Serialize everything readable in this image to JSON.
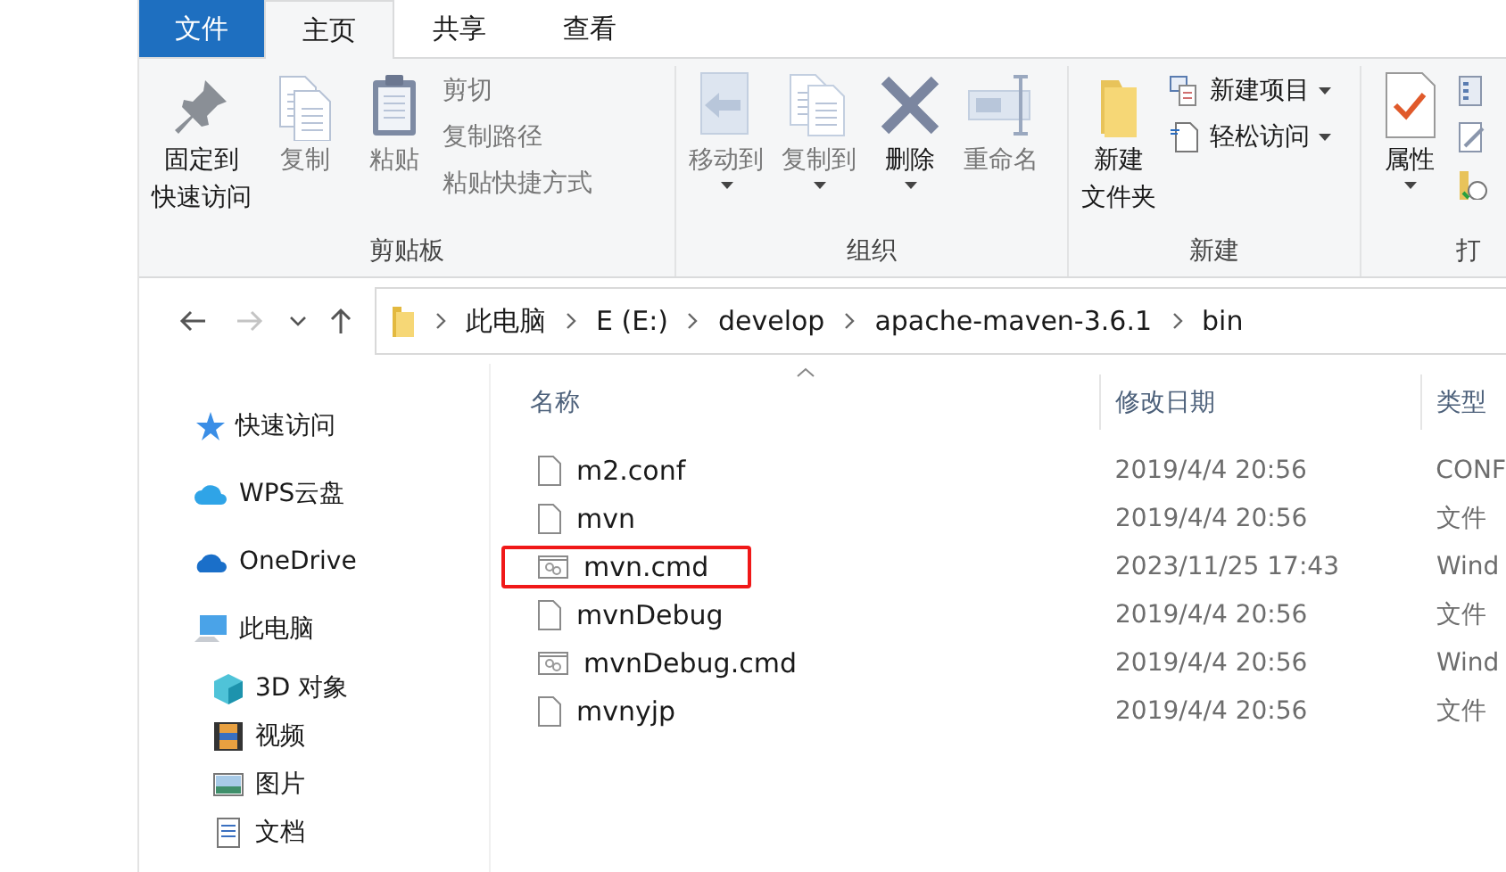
{
  "ribbon_tabs": [
    {
      "label": "文件",
      "kind": "file",
      "selected": false
    },
    {
      "label": "主页",
      "kind": "tab",
      "selected": true
    },
    {
      "label": "共享",
      "kind": "tab",
      "selected": false
    },
    {
      "label": "查看",
      "kind": "tab",
      "selected": false
    }
  ],
  "ribbon_groups": [
    {
      "label": "剪贴板",
      "items": [
        {
          "lines": [
            "固定到",
            "快速访问"
          ],
          "kind": "large",
          "disabled": false,
          "dropdown": false
        },
        {
          "label": "复制",
          "kind": "large",
          "disabled": true,
          "dropdown": false
        },
        {
          "label": "粘贴",
          "kind": "large",
          "disabled": true,
          "dropdown": false
        },
        {
          "label": "剪切",
          "kind": "small",
          "disabled": true,
          "dropdown": false
        },
        {
          "label": "复制路径",
          "kind": "small",
          "disabled": true,
          "dropdown": false
        },
        {
          "label": "粘贴快捷方式",
          "kind": "small",
          "disabled": true,
          "dropdown": false
        }
      ]
    },
    {
      "label": "组织",
      "items": [
        {
          "label": "移动到",
          "kind": "large",
          "disabled": true,
          "dropdown": true
        },
        {
          "label": "复制到",
          "kind": "large",
          "disabled": true,
          "dropdown": true
        },
        {
          "label": "删除",
          "kind": "large",
          "disabled": false,
          "dropdown": true
        },
        {
          "label": "重命名",
          "kind": "large",
          "disabled": true,
          "dropdown": false
        }
      ]
    },
    {
      "label": "新建",
      "items": [
        {
          "lines": [
            "新建",
            "文件夹"
          ],
          "kind": "large",
          "disabled": false,
          "dropdown": false
        },
        {
          "label": "新建项目",
          "kind": "small",
          "disabled": false,
          "dropdown": true
        },
        {
          "label": "轻松访问",
          "kind": "small",
          "disabled": false,
          "dropdown": true
        }
      ]
    },
    {
      "label": "打",
      "items": [
        {
          "label": "属性",
          "kind": "large",
          "disabled": false,
          "dropdown": true
        },
        {
          "kind": "small"
        },
        {
          "kind": "small"
        },
        {
          "kind": "small"
        }
      ]
    }
  ],
  "nav_buttons": [
    {
      "kind": "back",
      "disabled": false
    },
    {
      "kind": "forward",
      "disabled": true
    },
    {
      "kind": "recent",
      "disabled": false
    },
    {
      "kind": "up",
      "disabled": false
    }
  ],
  "breadcrumb": [
    "此电脑",
    "E (E:)",
    "develop",
    "apache-maven-3.6.1",
    "bin"
  ],
  "navigation_pane": [
    {
      "label": "快速访问",
      "kind": "quick"
    },
    {
      "label": "WPS云盘",
      "kind": "cloud"
    },
    {
      "label": "OneDrive",
      "kind": "onedrive"
    },
    {
      "label": "此电脑",
      "kind": "pc",
      "children": [
        {
          "label": "3D 对象",
          "kind": "cube"
        },
        {
          "label": "视频",
          "kind": "video"
        },
        {
          "label": "图片",
          "kind": "image"
        },
        {
          "label": "文档",
          "kind": "docs"
        }
      ]
    }
  ],
  "columns": [
    {
      "label": "名称",
      "sorted": true
    },
    {
      "label": "修改日期",
      "sorted": false
    },
    {
      "label": "类型",
      "sorted": false
    }
  ],
  "files": [
    {
      "name": "m2.conf",
      "date": "2019/4/4 20:56",
      "type": "CONF",
      "kind": "file",
      "annotated": false
    },
    {
      "name": "mvn",
      "date": "2019/4/4 20:56",
      "type": "文件",
      "kind": "file",
      "annotated": false
    },
    {
      "name": "mvn.cmd",
      "date": "2023/11/25 17:43",
      "type": "Wind",
      "kind": "cmd",
      "annotated": true
    },
    {
      "name": "mvnDebug",
      "date": "2019/4/4 20:56",
      "type": "文件",
      "kind": "file",
      "annotated": false
    },
    {
      "name": "mvnDebug.cmd",
      "date": "2019/4/4 20:56",
      "type": "Wind",
      "kind": "cmd",
      "annotated": false
    },
    {
      "name": "mvnyjp",
      "date": "2019/4/4 20:56",
      "type": "文件",
      "kind": "file",
      "annotated": false
    }
  ]
}
